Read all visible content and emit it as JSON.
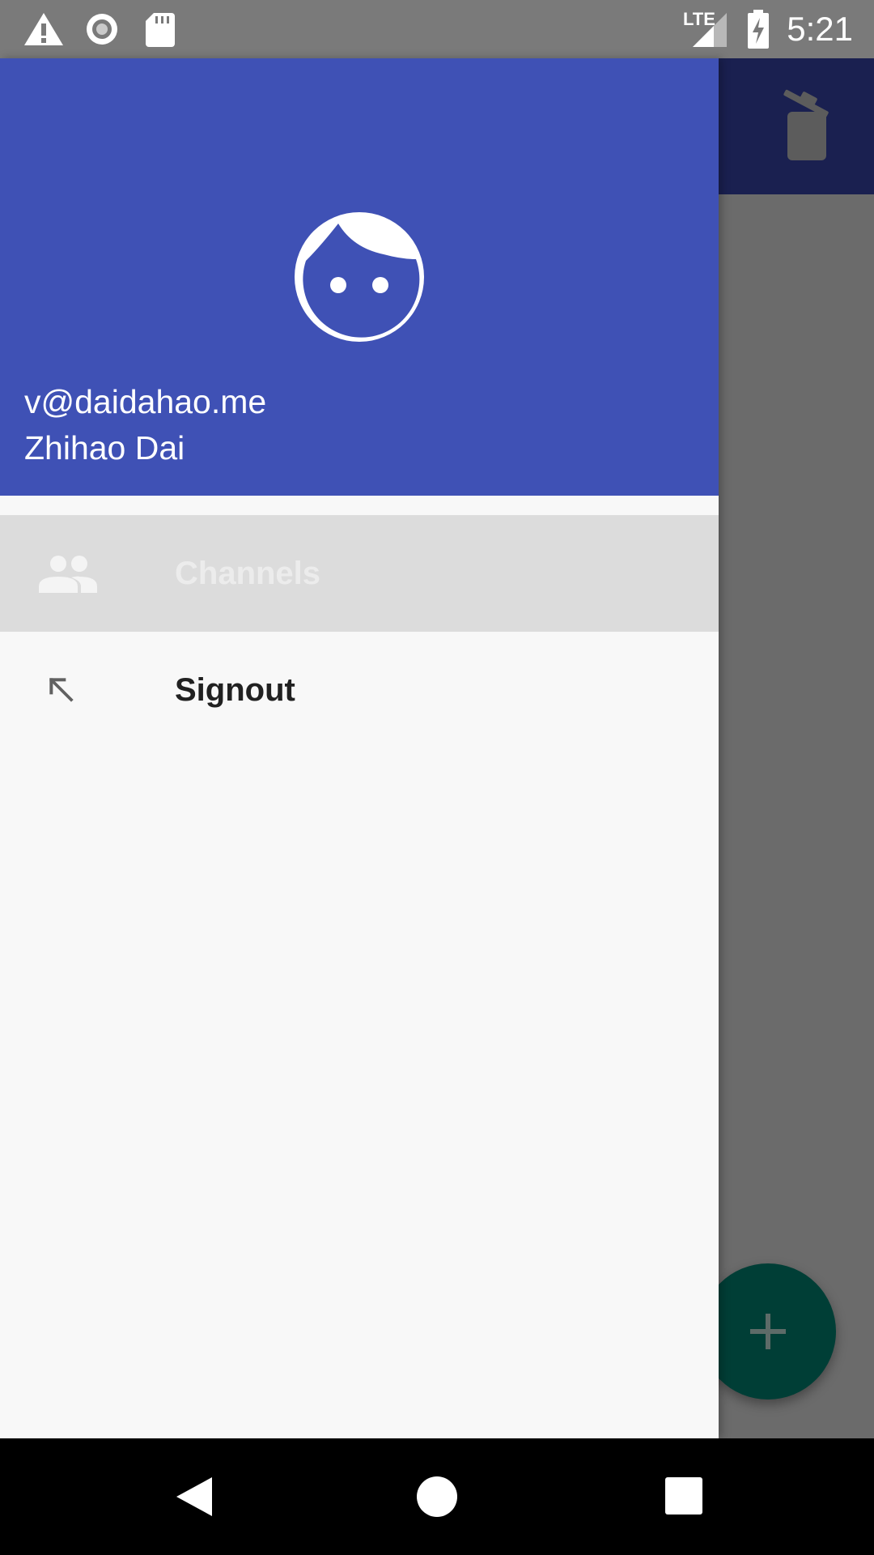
{
  "status_bar": {
    "time": "5:21",
    "network_label": "LTE",
    "icons": [
      "warning-icon",
      "sync-icon",
      "sd-card-icon",
      "lte-signal-icon",
      "battery-charging-icon"
    ]
  },
  "background_app": {
    "appbar_icons": [
      "delete-icon"
    ],
    "fab_icon": "add-icon"
  },
  "drawer": {
    "header": {
      "avatar_icon": "face-icon",
      "email": "v@daidahao.me",
      "name": "Zhihao Dai"
    },
    "items": [
      {
        "label": "Channels",
        "icon": "people-icon",
        "selected": true
      },
      {
        "label": "Signout",
        "icon": "arrow-up-left-icon",
        "selected": false
      }
    ]
  },
  "nav_bar": {
    "buttons": [
      "back-icon",
      "home-icon",
      "recents-icon"
    ]
  },
  "colors": {
    "primary": "#3f51b5",
    "drawer_bg": "#f8f8f8",
    "selected_item_bg": "#dcdcdc",
    "fab": "#003e36"
  }
}
